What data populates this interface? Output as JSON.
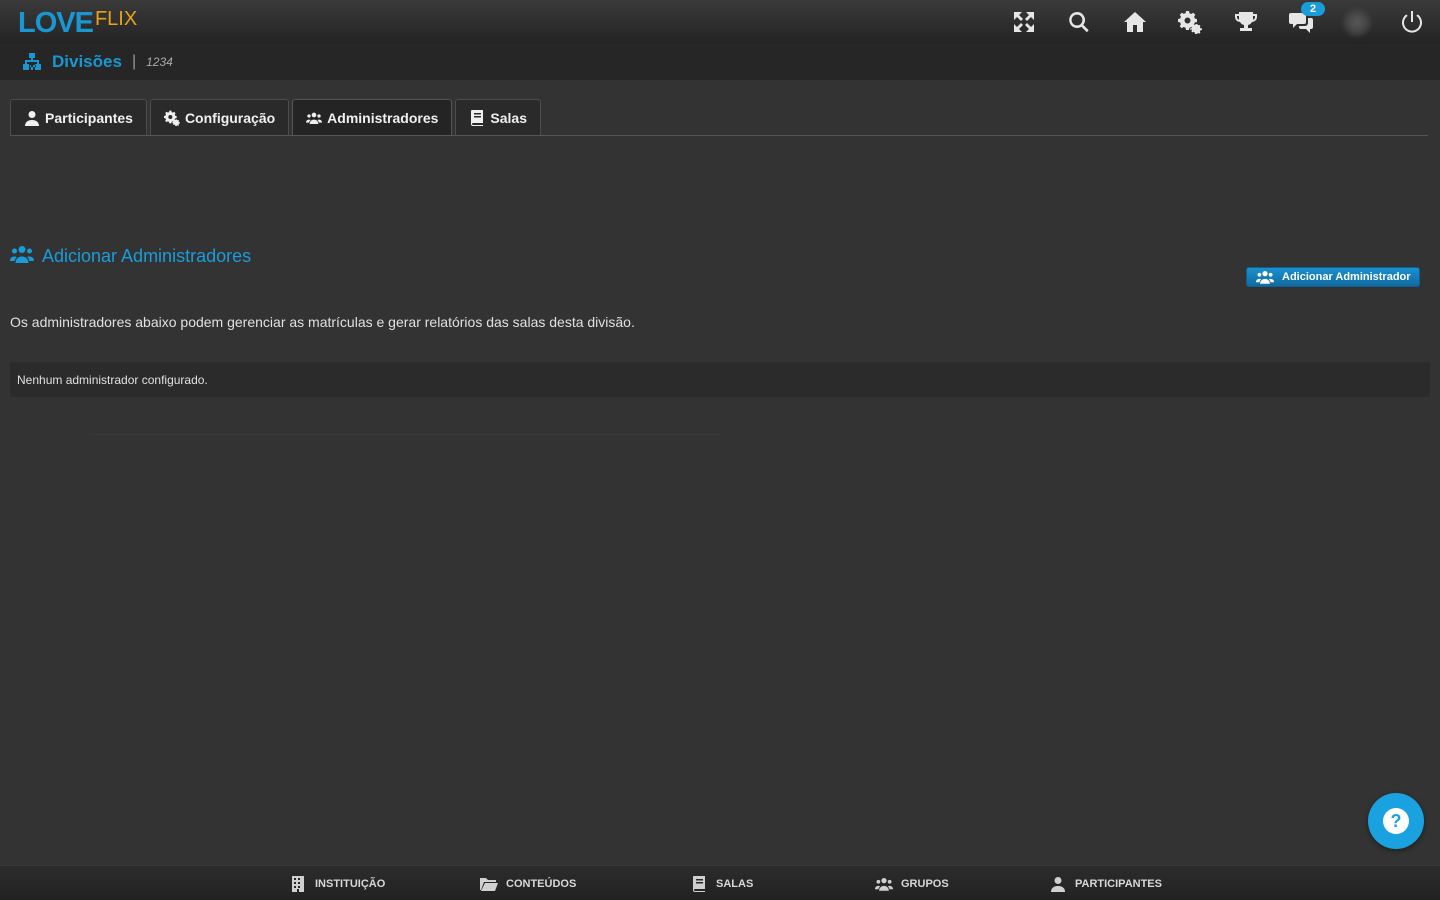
{
  "header": {
    "logo_main": "LOVE",
    "logo_sub": "FLIX",
    "icons": [
      "fullscreen-icon",
      "search-icon",
      "home-icon",
      "gears-icon",
      "trophy-icon",
      "chat-icon",
      "avatar",
      "power-icon"
    ],
    "notification_count": "2"
  },
  "breadcrumb": {
    "title": "Divisões",
    "separator": "|",
    "code": "1234"
  },
  "tabs": [
    {
      "label": "Participantes",
      "icon": "user-icon"
    },
    {
      "label": "Configuração",
      "icon": "gears-icon"
    },
    {
      "label": "Administradores",
      "icon": "users-icon",
      "active": true
    },
    {
      "label": "Salas",
      "icon": "book-icon"
    }
  ],
  "section": {
    "title": "Adicionar Administradores",
    "add_button": "Adicionar Administrador",
    "description": "Os administradores abaixo podem gerenciar as matrículas e gerar relatórios das salas desta divisão.",
    "empty_message": "Nenhum administrador configurado."
  },
  "help": {
    "label": "?"
  },
  "bottom_nav": [
    {
      "label": "INSTITUIÇÃO",
      "icon": "building-icon"
    },
    {
      "label": "CONTEÚDOS",
      "icon": "folder-icon"
    },
    {
      "label": "SALAS",
      "icon": "book-icon"
    },
    {
      "label": "GRUPOS",
      "icon": "users-icon"
    },
    {
      "label": "PARTICIPANTES",
      "icon": "user-icon"
    }
  ],
  "colors": {
    "accent": "#1a96d2",
    "logo_flix": "#e8a317",
    "background": "#333333"
  }
}
